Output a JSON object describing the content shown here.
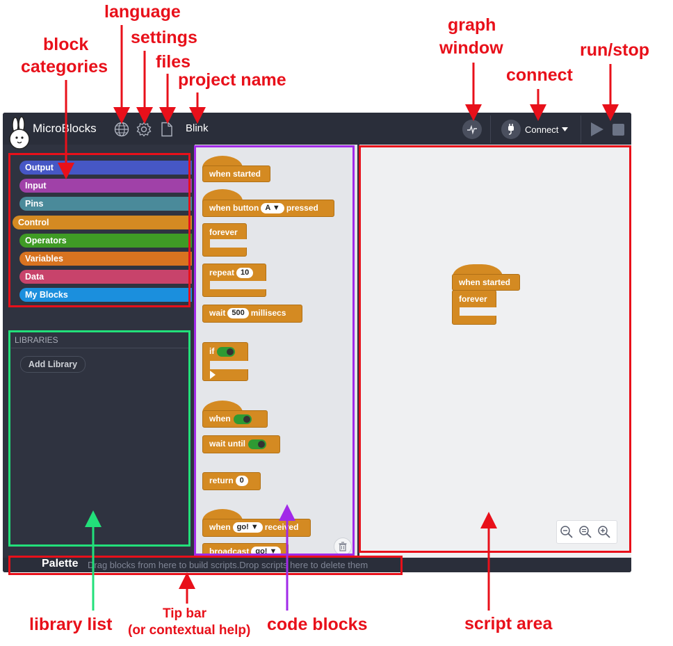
{
  "annotations": {
    "language": "language",
    "settings": "settings",
    "files": "files",
    "project_name": "project name",
    "block_categories_1": "block",
    "block_categories_2": "categories",
    "graph_window_1": "graph",
    "graph_window_2": "window",
    "connect": "connect",
    "run_stop": "run/stop",
    "library_list": "library list",
    "tip_bar_1": "Tip bar",
    "tip_bar_2": "(or contextual help)",
    "code_blocks": "code blocks",
    "script_area": "script area",
    "colors": {
      "arrow": "#e8101a",
      "categories_box": "#e8101a",
      "libraries_box": "#22e07a",
      "palette_box": "#a12ae8",
      "script_box": "#e8101a",
      "tip_box": "#e8101a",
      "library_arrow": "#22e07a",
      "palette_arrow": "#a12ae8"
    }
  },
  "app": {
    "name": "MicroBlocks",
    "project_name": "Blink",
    "icons": [
      "globe-icon",
      "gear-icon",
      "file-icon",
      "graph-icon",
      "plug-icon",
      "play-icon",
      "stop-icon"
    ],
    "connect_label": "Connect"
  },
  "categories": [
    {
      "label": "Output",
      "color": "#4657c5"
    },
    {
      "label": "Input",
      "color": "#a041a8"
    },
    {
      "label": "Pins",
      "color": "#4a8a9a"
    },
    {
      "label": "Control",
      "color": "#d48a22"
    },
    {
      "label": "Operators",
      "color": "#3f9b25"
    },
    {
      "label": "Variables",
      "color": "#d87320"
    },
    {
      "label": "Data",
      "color": "#c8436b"
    },
    {
      "label": "My Blocks",
      "color": "#1b8fdd"
    }
  ],
  "libraries": {
    "header": "LIBRARIES",
    "add_button": "Add Library"
  },
  "palette": {
    "when_started": "when started",
    "when_button": "when button",
    "button_value": "A",
    "pressed": "pressed",
    "forever": "forever",
    "repeat": "repeat",
    "repeat_value": "10",
    "wait": "wait",
    "wait_value": "500",
    "millisecs": "millisecs",
    "if": "if",
    "when": "when",
    "wait_until": "wait until",
    "return": "return",
    "return_value": "0",
    "when_msg": "when",
    "msg_value": "go!",
    "received": "received",
    "broadcast": "broadcast",
    "broadcast_value": "go!"
  },
  "script": {
    "when_started": "when started",
    "forever": "forever"
  },
  "tipbar": {
    "title": "Palette",
    "text": "Drag blocks from here to build scripts.Drop scripts here to delete them"
  }
}
